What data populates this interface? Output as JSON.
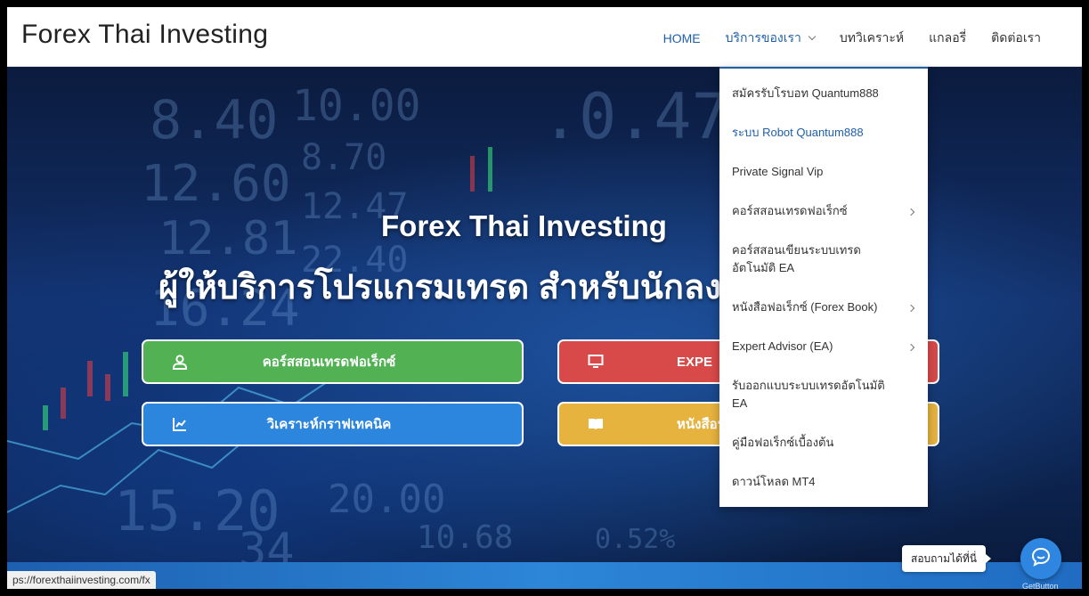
{
  "site": {
    "title": "Forex Thai Investing"
  },
  "nav": {
    "items": [
      {
        "label": "HOME",
        "active": true
      },
      {
        "label": "บริการของเรา",
        "has_dropdown": true
      },
      {
        "label": "บทวิเคราะห์"
      },
      {
        "label": "แกลอรี่"
      },
      {
        "label": "ติดต่อเรา"
      }
    ]
  },
  "dropdown": {
    "items": [
      {
        "label": "สมัครรับโรบอท Quantum888",
        "submenu": false
      },
      {
        "label": "ระบบ Robot Quantum888",
        "submenu": false,
        "highlight": true
      },
      {
        "label": "Private Signal Vip",
        "submenu": false
      },
      {
        "label": "คอร์สสอนเทรดฟอเร็กซ์",
        "submenu": true
      },
      {
        "label": "คอร์สสอนเขียนระบบเทรดอัตโนมัติ EA",
        "submenu": false
      },
      {
        "label": "หนังสือฟอเร็กซ์ (Forex Book)",
        "submenu": true
      },
      {
        "label": "Expert Advisor (EA)",
        "submenu": true
      },
      {
        "label": "รับออกแบบระบบเทรดอัตโนมัติ EA",
        "submenu": false
      },
      {
        "label": "คู่มือฟอเร็กซ์เบื้องต้น",
        "submenu": false
      },
      {
        "label": "ดาวน์โหลด MT4",
        "submenu": false
      }
    ]
  },
  "hero": {
    "title": "Forex Thai Investing",
    "subtitle": "ผู้ให้บริการโปรแกรมเทรด สำหรับนักลงทุ",
    "buttons": [
      {
        "label": "คอร์สสอนเทรดฟอเร็กซ์",
        "icon": "user-icon",
        "color": "#52b153"
      },
      {
        "label": "EXPE",
        "icon": "monitor-icon",
        "color": "#d84a4a"
      },
      {
        "label": "วิเคราะห์กราฟเทคนิค",
        "icon": "chart-line-icon",
        "color": "#2d86de"
      },
      {
        "label": "หนังสือฟ",
        "icon": "book-icon",
        "color": "#e6b33f"
      }
    ]
  },
  "status_bar": {
    "url": "ps://forexthaiinvesting.com/fx"
  },
  "chat": {
    "tooltip": "สอบถามได้ที่นี่",
    "brand": "GetButton",
    "icon": "chat-bubble-icon",
    "color": "#2f86e0"
  }
}
